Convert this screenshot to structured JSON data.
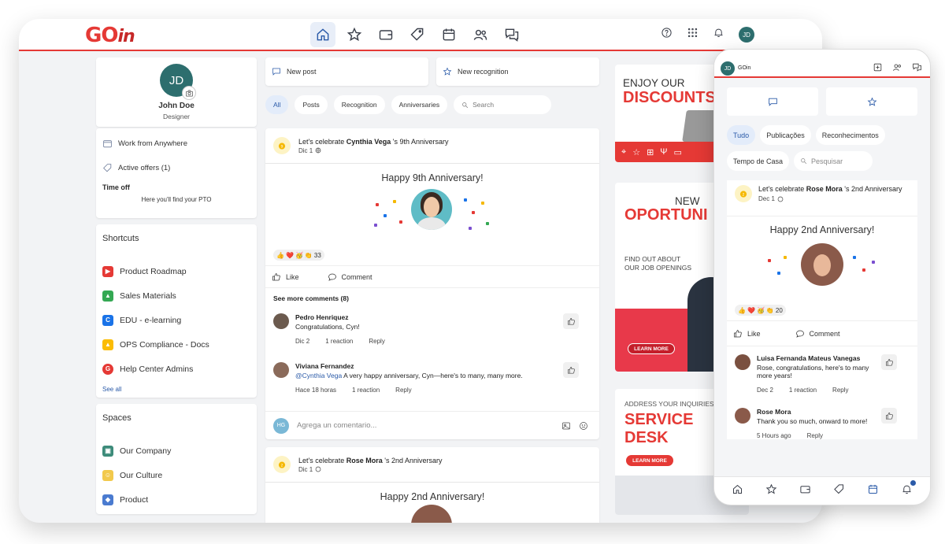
{
  "brand": {
    "go": "GO",
    "in": "in"
  },
  "user": {
    "initials": "JD",
    "name": "John Doe",
    "role": "Designer"
  },
  "left": {
    "work": "Work from Anywhere",
    "offers": "Active offers (1)",
    "timeoff_title": "Time off",
    "timeoff_sub": "Here you'll find your PTO",
    "shortcuts_title": "Shortcuts",
    "shortcuts": [
      {
        "label": "Product Roadmap",
        "icon": "roadmap-icon",
        "color": "#e53935"
      },
      {
        "label": "Sales Materials",
        "icon": "drive-icon",
        "color": "#34a853"
      },
      {
        "label": "EDU - e-learning",
        "icon": "edu-icon",
        "color": "#1a73e8"
      },
      {
        "label": "OPS Compliance - Docs",
        "icon": "drive-icon",
        "color": "#fbbc04"
      },
      {
        "label": "Help Center Admins",
        "icon": "goin-icon",
        "color": "#e53935"
      }
    ],
    "see_all": "See all",
    "spaces_title": "Spaces",
    "spaces": [
      {
        "label": "Our Company",
        "color": "#3d8b7a"
      },
      {
        "label": "Our Culture",
        "color": "#f2c94c"
      },
      {
        "label": "Product",
        "color": "#4a7bd0"
      }
    ]
  },
  "feed": {
    "new_post": "New post",
    "new_recognition": "New recognition",
    "filters": [
      "All",
      "Posts",
      "Recognition",
      "Anniversaries"
    ],
    "search_placeholder": "Search",
    "post1": {
      "title_pre": "Let's celebrate ",
      "title_name": "Cynthia Vega",
      "title_post": " 's 9th Anniversary",
      "date": "Dic 1",
      "happy": "Happy 9th Anniversary!",
      "reaction_count": "33",
      "like": "Like",
      "comment": "Comment",
      "see_more": "See more comments (8)",
      "comments": [
        {
          "name": "Pedro Henriquez",
          "mention": "",
          "text": "Congratulations, Cyn!",
          "time": "Dic 2",
          "reactions": "1 reaction",
          "reply": "Reply"
        },
        {
          "name": "Viviana Fernandez",
          "mention": "@Cynthia Vega",
          "text": " A very happy anniversary, Cyn—here's to many, many more.",
          "time": "Hace 18 horas",
          "reactions": "1 reaction",
          "reply": "Reply"
        }
      ],
      "commenter_initials": "HG",
      "add_comment_placeholder": "Agrega un comentario..."
    },
    "post2": {
      "title_pre": "Let's celebrate ",
      "title_name": "Rose Mora",
      "title_post": " 's 2nd Anniversary",
      "date": "Dic 1",
      "happy": "Happy 2nd Anniversary!"
    }
  },
  "ads": {
    "ad1_line1": "ENJOY OUR",
    "ad1_line2": "DISCOUNTS",
    "ad2_line1": "NEW",
    "ad2_line2": "OPORTUNI",
    "ad2_line3": "FIND OUT ABOUT",
    "ad2_line4": "OUR JOB OPENINGS",
    "learn_more": "LEARN MORE",
    "ad3_line1": "ADDRESS YOUR INQUIRIES",
    "ad3_line2": "SERVICE",
    "ad3_line3": "DESK"
  },
  "mobile": {
    "brand": "GOin",
    "filters": [
      "Tudo",
      "Publicações",
      "Reconhecimentos",
      "Tempo de Casa"
    ],
    "search_placeholder": "Pesquisar",
    "post": {
      "title_pre": "Let's celebrate ",
      "title_name": "Rose Mora",
      "title_post": " 's 2nd Anniversary",
      "date": "Dec 1",
      "happy": "Happy 2nd Anniversary!",
      "reaction_count": "20",
      "like": "Like",
      "comment": "Comment",
      "comments": [
        {
          "name": "Luisa Fernanda Mateus Vanegas",
          "text": "Rose, congratulations, here's to many more years!",
          "time": "Dec 2",
          "reactions": "1 reaction",
          "reply": "Reply"
        },
        {
          "name": "Rose Mora",
          "text": "Thank you so much, onward to more!",
          "time": "5 Hours ago",
          "reactions": "",
          "reply": "Reply"
        }
      ]
    }
  }
}
